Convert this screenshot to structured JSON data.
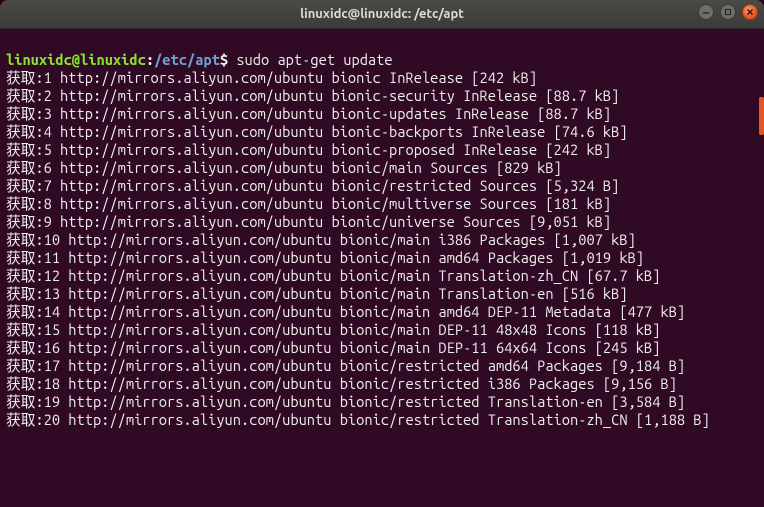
{
  "window": {
    "title": "linuxidc@linuxidc: /etc/apt"
  },
  "prompt": {
    "user_host": "linuxidc@linuxidc",
    "sep1": ":",
    "path": "/etc/apt",
    "sep2": "$ ",
    "command": "sudo apt-get update"
  },
  "output": [
    "获取:1 http://mirrors.aliyun.com/ubuntu bionic InRelease [242 kB]",
    "获取:2 http://mirrors.aliyun.com/ubuntu bionic-security InRelease [88.7 kB]",
    "获取:3 http://mirrors.aliyun.com/ubuntu bionic-updates InRelease [88.7 kB]",
    "获取:4 http://mirrors.aliyun.com/ubuntu bionic-backports InRelease [74.6 kB]",
    "获取:5 http://mirrors.aliyun.com/ubuntu bionic-proposed InRelease [242 kB]",
    "获取:6 http://mirrors.aliyun.com/ubuntu bionic/main Sources [829 kB]",
    "获取:7 http://mirrors.aliyun.com/ubuntu bionic/restricted Sources [5,324 B]",
    "获取:8 http://mirrors.aliyun.com/ubuntu bionic/multiverse Sources [181 kB]",
    "获取:9 http://mirrors.aliyun.com/ubuntu bionic/universe Sources [9,051 kB]",
    "获取:10 http://mirrors.aliyun.com/ubuntu bionic/main i386 Packages [1,007 kB]",
    "获取:11 http://mirrors.aliyun.com/ubuntu bionic/main amd64 Packages [1,019 kB]",
    "获取:12 http://mirrors.aliyun.com/ubuntu bionic/main Translation-zh_CN [67.7 kB]",
    "获取:13 http://mirrors.aliyun.com/ubuntu bionic/main Translation-en [516 kB]",
    "获取:14 http://mirrors.aliyun.com/ubuntu bionic/main amd64 DEP-11 Metadata [477 kB]",
    "获取:15 http://mirrors.aliyun.com/ubuntu bionic/main DEP-11 48x48 Icons [118 kB]",
    "获取:16 http://mirrors.aliyun.com/ubuntu bionic/main DEP-11 64x64 Icons [245 kB]",
    "获取:17 http://mirrors.aliyun.com/ubuntu bionic/restricted amd64 Packages [9,184 B]",
    "获取:18 http://mirrors.aliyun.com/ubuntu bionic/restricted i386 Packages [9,156 B]",
    "获取:19 http://mirrors.aliyun.com/ubuntu bionic/restricted Translation-en [3,584 B]",
    "获取:20 http://mirrors.aliyun.com/ubuntu bionic/restricted Translation-zh_CN [1,188 B]"
  ]
}
